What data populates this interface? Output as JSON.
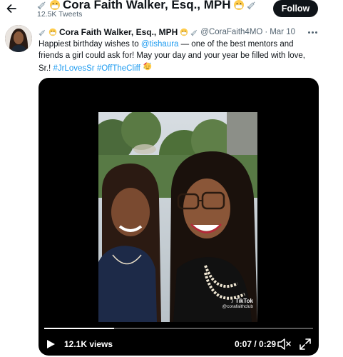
{
  "header": {
    "name": "Cora Faith Walker, Esq., MPH",
    "tweet_count": "12.5K Tweets",
    "follow_label": "Follow",
    "name_emojis": [
      "syringe-icon",
      "mask-face-icon"
    ]
  },
  "tweet": {
    "display_name": "Cora Faith Walker, Esq., MPH",
    "handle": "@CoraFaith4MO",
    "separator": "·",
    "date": "Mar 10",
    "text_line1_a": "Happiest birthday wishes to ",
    "mention": "@tishaura",
    "text_line1_b": " — one of the best mentors and",
    "text_line2": "friends a girl could ask for! May your day and your year be filled with love,",
    "text_line3_a": "Sr.! ",
    "hashtag1": "#JrLovesSr",
    "hashtag2": "#OffTheCliff",
    "trailing_emoji": "party-face-icon"
  },
  "video": {
    "watermark": "TikTok",
    "watermark_user": "@corafaithclub",
    "views": "12.1K views",
    "time": "0:07 / 0:29",
    "progress": 0.26
  },
  "colors": {
    "accent": "#1d9bf0",
    "text": "#0f1419",
    "muted": "#536471",
    "follow_bg": "#0f1419"
  }
}
